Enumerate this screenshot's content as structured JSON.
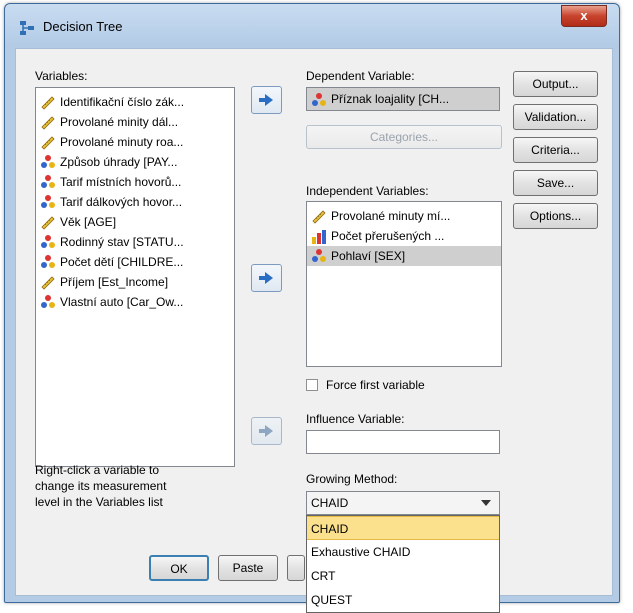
{
  "window": {
    "title": "Decision Tree",
    "close_glyph": "x"
  },
  "variables": {
    "label": "Variables:",
    "items": [
      {
        "icon": "ruler-icon",
        "text": "Identifikační číslo zák..."
      },
      {
        "icon": "ruler-icon",
        "text": "Provolané minity dál..."
      },
      {
        "icon": "ruler-icon",
        "text": "Provolané minuty roa..."
      },
      {
        "icon": "nominal-icon",
        "text": "Způsob úhrady [PAY..."
      },
      {
        "icon": "nominal-icon",
        "text": "Tarif místních hovorů..."
      },
      {
        "icon": "nominal-icon",
        "text": "Tarif dálkových hovor..."
      },
      {
        "icon": "ruler-icon",
        "text": "Věk [AGE]"
      },
      {
        "icon": "nominal-icon",
        "text": "Rodinný stav [STATU..."
      },
      {
        "icon": "nominal-icon",
        "text": "Počet dětí [CHILDRE..."
      },
      {
        "icon": "ruler-icon",
        "text": "Příjem [Est_Income]"
      },
      {
        "icon": "nominal-icon",
        "text": "Vlastní auto [Car_Ow..."
      }
    ],
    "hint": [
      "Right-click a variable to",
      "change its measurement",
      "level in the Variables list"
    ]
  },
  "dependent": {
    "label": "Dependent Variable:",
    "value": "Příznak loajality [CH...",
    "categories_label": "Categories..."
  },
  "independent": {
    "label": "Independent Variables:",
    "items": [
      {
        "icon": "ruler-icon",
        "text": "Provolané minuty mí..."
      },
      {
        "icon": "bar-chart-icon",
        "text": "Počet přerušených ..."
      },
      {
        "icon": "nominal-icon",
        "text": "Pohlaví [SEX]"
      }
    ],
    "force_first_label": "Force first variable"
  },
  "influence": {
    "label": "Influence Variable:",
    "value": ""
  },
  "growing": {
    "label": "Growing Method:",
    "selected": "CHAID",
    "options": [
      "CHAID",
      "Exhaustive CHAID",
      "CRT",
      "QUEST"
    ]
  },
  "side_buttons": [
    "Output...",
    "Validation...",
    "Criteria...",
    "Save...",
    "Options..."
  ],
  "bottom_buttons": {
    "ok": "OK",
    "paste": "Paste"
  },
  "colors": {
    "accent": "#2a6ec4",
    "selection": "#fbe08e"
  }
}
